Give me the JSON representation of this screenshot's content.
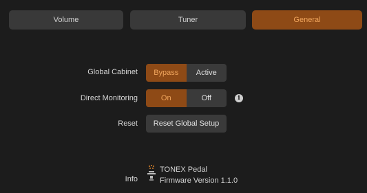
{
  "tabs": [
    {
      "label": "Volume",
      "active": false
    },
    {
      "label": "Tuner",
      "active": false
    },
    {
      "label": "General",
      "active": true
    }
  ],
  "global_cabinet": {
    "label": "Global Cabinet",
    "options": [
      "Bypass",
      "Active"
    ],
    "selected": "Bypass"
  },
  "direct_monitoring": {
    "label": "Direct Monitoring",
    "options": [
      "On",
      "Off"
    ],
    "selected": "On",
    "info_icon": "info-icon"
  },
  "reset": {
    "label": "Reset",
    "button_label": "Reset Global Setup"
  },
  "info": {
    "label": "Info",
    "device_icon": "pedal-icon",
    "device_name": "TONEX Pedal",
    "firmware": "Firmware Version 1.1.0"
  },
  "colors": {
    "background": "#1c1c1c",
    "control": "#3a3a3a",
    "accent_bg": "#8e4a16",
    "accent_text": "#f0a55c"
  }
}
